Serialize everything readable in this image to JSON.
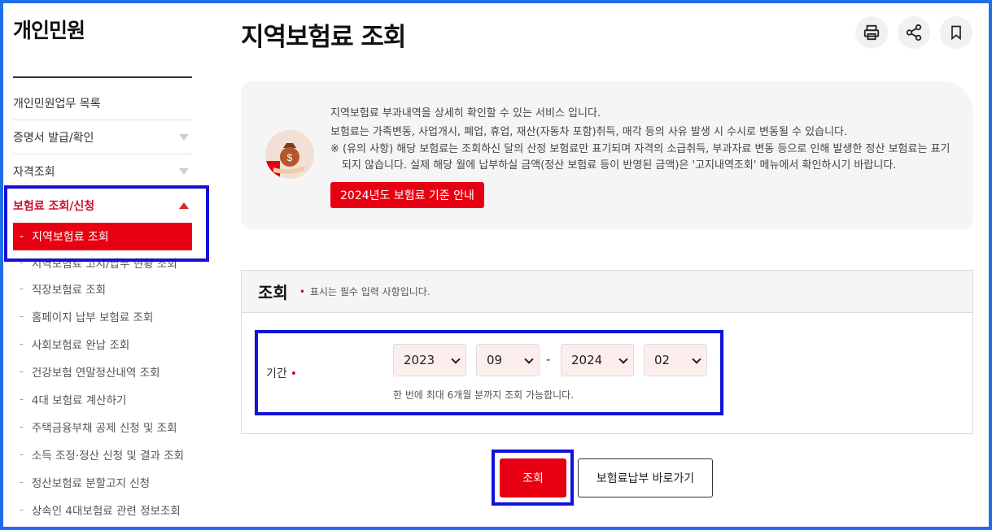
{
  "sidebar": {
    "title": "개인민원",
    "items": [
      {
        "label": "개인민원업무 목록"
      },
      {
        "label": "증명서 발급/확인"
      },
      {
        "label": "자격조회"
      },
      {
        "label": "보험료 조회/신청"
      }
    ],
    "active_sub": "지역보험료 조회",
    "hidden_sub": "지역보험료 고지/납부 현황 조회",
    "sub_items": [
      "직장보험료 조회",
      "홈페이지 납부 보험료 조회",
      "사회보험료 완납 조회",
      "건강보험 연말정산내역 조회",
      "4대 보험료 계산하기",
      "주택금융부채 공제 신청 및 조회",
      "소득 조정·정산 신청 및 결과 조회",
      "정산보험료 분할고지 신청",
      "상속인 4대보험료 관련 정보조회"
    ]
  },
  "page": {
    "title": "지역보험료 조회",
    "icons": [
      "print-icon",
      "share-icon",
      "bookmark-icon"
    ]
  },
  "info": {
    "line1": "지역보험료 부과내역을 상세히 확인할 수 있는 서비스 입니다.",
    "line2": "보험료는 가족변동, 사업개시, 폐업, 휴업, 재산(자동차 포함)취득, 매각 등의 사유 발생 시 수시로 변동될 수 있습니다.",
    "note": "※ (유의 사항) 해당 보험료는 조회하신 달의 산정 보험료만 표기되며 자격의 소급취득, 부과자료 변동 등으로 인해 발생한 정산 보험료는 표기되지 않습니다. 실제 해당 월에 납부하실 금액(정산 보험료 등이 반영된 금액)은 '고지내역조회' 메뉴에서 확인하시기 바랍니다.",
    "guide_button": "2024년도 보험료 기준 안내"
  },
  "search": {
    "heading": "조회",
    "required_marker": "•",
    "required_text": "표시는 필수 입력 사항입니다.",
    "period_label": "기간",
    "period_required": "•",
    "from_year": "2023",
    "from_month": "09",
    "separator": "-",
    "to_year": "2024",
    "to_month": "02",
    "help_text": "한 번에 최대 6개월 분까지 조회 가능합니다."
  },
  "actions": {
    "search_button": "조회",
    "pay_button": "보험료납부 바로가기"
  },
  "colors": {
    "accent_red": "#e60012",
    "highlight_blue": "#1212d8",
    "frame_blue": "#1f6fe6"
  }
}
